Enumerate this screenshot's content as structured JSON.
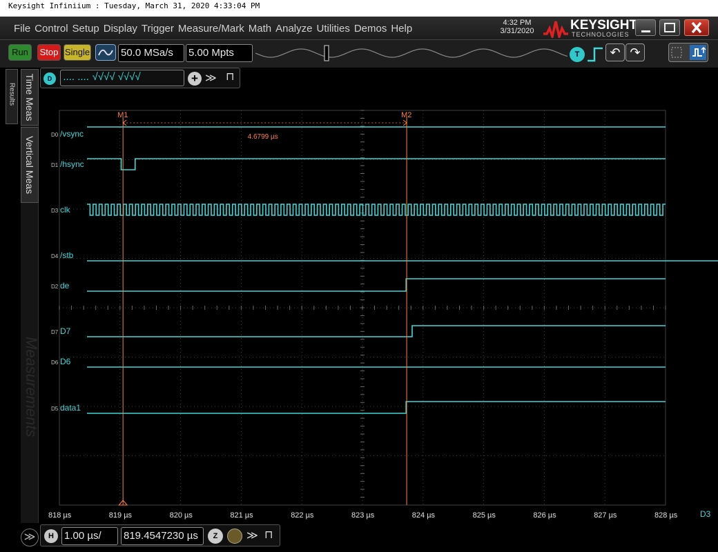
{
  "window": {
    "caption": "Keysight Infiniium : Tuesday, March 31, 2020 4:33:04 PM"
  },
  "menu": [
    "File",
    "Control",
    "Setup",
    "Display",
    "Trigger",
    "Measure/Mark",
    "Math",
    "Analyze",
    "Utilities",
    "Demos",
    "Help"
  ],
  "clock": {
    "time": "4:32 PM",
    "date": "3/31/2020"
  },
  "brand": {
    "name": "KEYSIGHT",
    "sub": "TECHNOLOGIES"
  },
  "toolbar": {
    "run": "Run",
    "stop": "Stop",
    "single": "Single",
    "sample_rate": "50.0 MSa/s",
    "memory_depth": "5.00 Mpts",
    "trigger_badge": "T",
    "undo": "↶",
    "redo": "↷"
  },
  "left": {
    "results_tab": "Results",
    "time_meas": "Time Meas",
    "vertical_meas": "Vertical Meas",
    "measurements": "Measurements"
  },
  "bus": {
    "badge": "D",
    "pattern": ".... .... √√√√ √√√√",
    "add": "+",
    "expand": "≫",
    "pin": "⊓"
  },
  "markers": [
    {
      "name": "M1",
      "time": 819.05
    },
    {
      "name": "M2",
      "time": 823.73
    }
  ],
  "delta_label": "4.6799 µs",
  "channels": [
    {
      "id": "D0",
      "label": "/vsync",
      "edges": [],
      "init": 1
    },
    {
      "id": "D1",
      "label": "/hsync",
      "edges": [
        819.02,
        819.25
      ],
      "init": 1
    },
    {
      "id": "D3",
      "label": "clk",
      "clock": true,
      "period": 0.1
    },
    {
      "id": "D4",
      "label": "/stb",
      "edges": [],
      "init": 1
    },
    {
      "id": "D2",
      "label": "de",
      "edges": [
        823.72
      ],
      "init": 0
    },
    {
      "id": "D7",
      "label": "D7",
      "edges": [
        823.82
      ],
      "init": 0
    },
    {
      "id": "D6",
      "label": "D6",
      "edges": [],
      "init": 0
    },
    {
      "id": "D5",
      "label": "data1",
      "edges": [
        823.72
      ],
      "init": 0
    }
  ],
  "x_axis": {
    "min": 818,
    "max": 828,
    "ticks": [
      "818 µs",
      "819 µs",
      "820 µs",
      "821 µs",
      "822 µs",
      "823 µs",
      "824 µs",
      "825 µs",
      "826 µs",
      "827 µs",
      "828 µs"
    ],
    "right_label": "D3"
  },
  "horizontal": {
    "badge": "H",
    "scale": "1.00 µs/",
    "position": "819.4547230 µs",
    "zoom_badge": "Z",
    "expand": "≫",
    "pin": "⊓"
  },
  "left_expand": "≫",
  "colors": {
    "wave": "#40d8d8",
    "marker": "#ff8040",
    "grid": "#505050",
    "bus_badge": "#30c8c8"
  }
}
